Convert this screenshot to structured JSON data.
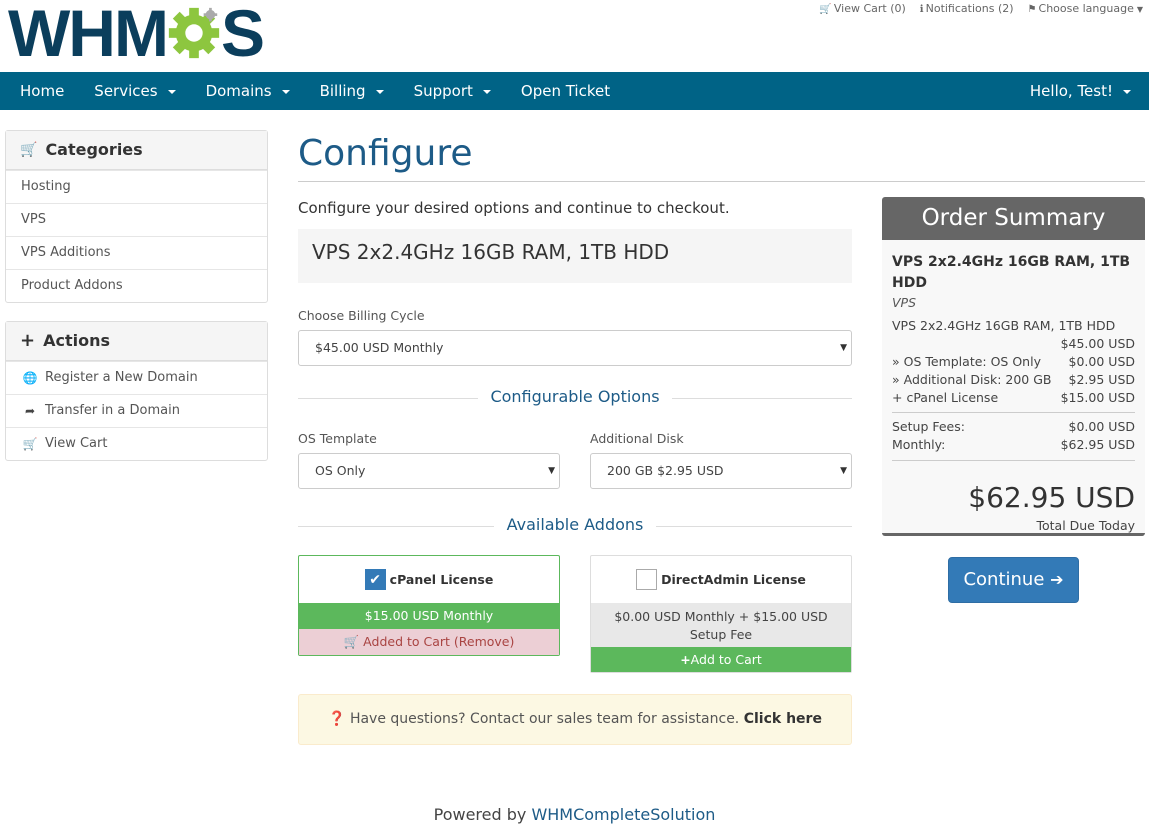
{
  "brand": {
    "logo_text_left": "WHM",
    "logo_text_right": "S"
  },
  "toplinks": {
    "cart": "View Cart (0)",
    "notifications": "Notifications (2)",
    "language": "Choose language"
  },
  "nav": {
    "home": "Home",
    "services": "Services",
    "domains": "Domains",
    "billing": "Billing",
    "support": "Support",
    "open_ticket": "Open Ticket",
    "user": "Hello, Test!"
  },
  "sidebar": {
    "categories_title": "Categories",
    "categories": [
      "Hosting",
      "VPS",
      "VPS Additions",
      "Product Addons"
    ],
    "actions_title": "Actions",
    "actions": [
      "Register a New Domain",
      "Transfer in a Domain",
      "View Cart"
    ]
  },
  "main": {
    "title": "Configure",
    "subtitle": "Configure your desired options and continue to checkout.",
    "product_name": "VPS 2x2.4GHz 16GB RAM, 1TB HDD",
    "billing_label": "Choose Billing Cycle",
    "billing_value": "$45.00 USD Monthly",
    "config_title": "Configurable Options",
    "os_label": "OS Template",
    "os_value": "OS Only",
    "disk_label": "Additional Disk",
    "disk_value": "200 GB $2.95 USD",
    "addons_title": "Available Addons",
    "addons": [
      {
        "name": "cPanel License",
        "price": "$15.00 USD Monthly",
        "action": "Added to Cart (Remove)",
        "checked": true
      },
      {
        "name": "DirectAdmin License",
        "price": "$0.00 USD Monthly + $15.00 USD Setup Fee",
        "action": "Add to Cart",
        "checked": false
      }
    ],
    "help_text": "Have questions? Contact our sales team for assistance.",
    "help_link": "Click here"
  },
  "summary": {
    "title": "Order Summary",
    "product": "VPS 2x2.4GHz 16GB RAM, 1TB HDD",
    "group": "VPS",
    "line_desc": "VPS 2x2.4GHz 16GB RAM, 1TB HDD",
    "base_price": "$45.00 USD",
    "items": [
      {
        "label": "» OS Template: OS Only",
        "price": "$0.00 USD"
      },
      {
        "label": "» Additional Disk: 200 GB",
        "price": "$2.95 USD"
      },
      {
        "label": "+ cPanel License",
        "price": "$15.00 USD"
      }
    ],
    "setup_label": "Setup Fees:",
    "setup_value": "$0.00 USD",
    "monthly_label": "Monthly:",
    "monthly_value": "$62.95 USD",
    "total": "$62.95 USD",
    "total_label": "Total Due Today"
  },
  "continue_label": "Continue",
  "footer": {
    "prefix": "Powered by",
    "link": "WHMCompleteSolution"
  },
  "colors": {
    "nav": "#006386",
    "accent": "#337ab7",
    "success": "#5cb85c",
    "logo": "#0b3e5c",
    "gear": "#8dc63f"
  }
}
